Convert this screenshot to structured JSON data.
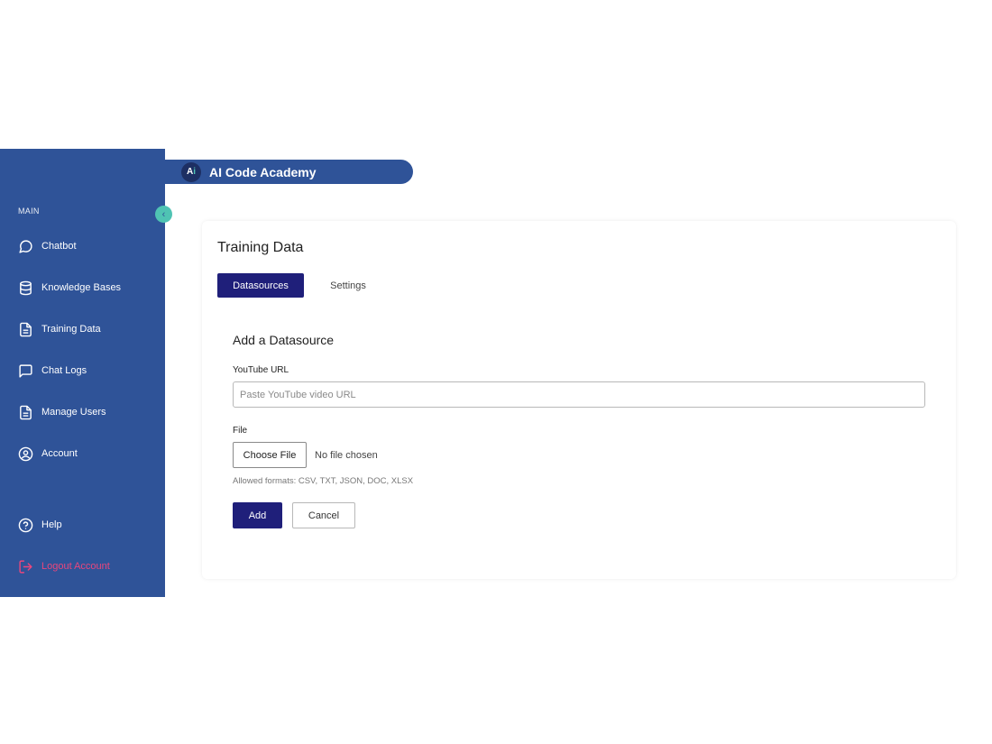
{
  "brand": {
    "title": "AI Code Academy",
    "logo_text_a": "A",
    "logo_text_i": "i"
  },
  "sidebar": {
    "section_label": "MAIN",
    "items": [
      {
        "label": "Chatbot",
        "icon": "chat-bubble-icon"
      },
      {
        "label": "Knowledge Bases",
        "icon": "database-icon"
      },
      {
        "label": "Training Data",
        "icon": "document-icon"
      },
      {
        "label": "Chat Logs",
        "icon": "message-square-icon"
      },
      {
        "label": "Manage Users",
        "icon": "document-icon"
      },
      {
        "label": "Account",
        "icon": "user-circle-icon"
      }
    ],
    "help_label": "Help",
    "logout_label": "Logout Account",
    "collapse_glyph": "‹"
  },
  "main": {
    "page_title": "Training Data",
    "tabs": [
      {
        "label": "Datasources",
        "active": true
      },
      {
        "label": "Settings",
        "active": false
      }
    ],
    "form": {
      "title": "Add a Datasource",
      "youtube_label": "YouTube URL",
      "youtube_placeholder": "Paste YouTube video URL",
      "youtube_value": "",
      "file_label": "File",
      "choose_file_label": "Choose File",
      "no_file_text": "No file chosen",
      "allowed_formats": "Allowed formats: CSV, TXT, JSON, DOC, XLSX",
      "add_label": "Add",
      "cancel_label": "Cancel"
    }
  },
  "colors": {
    "sidebar_bg": "#2f5398",
    "primary": "#1f1f7a",
    "accent": "#4fc3b3",
    "logout": "#e9467c"
  }
}
